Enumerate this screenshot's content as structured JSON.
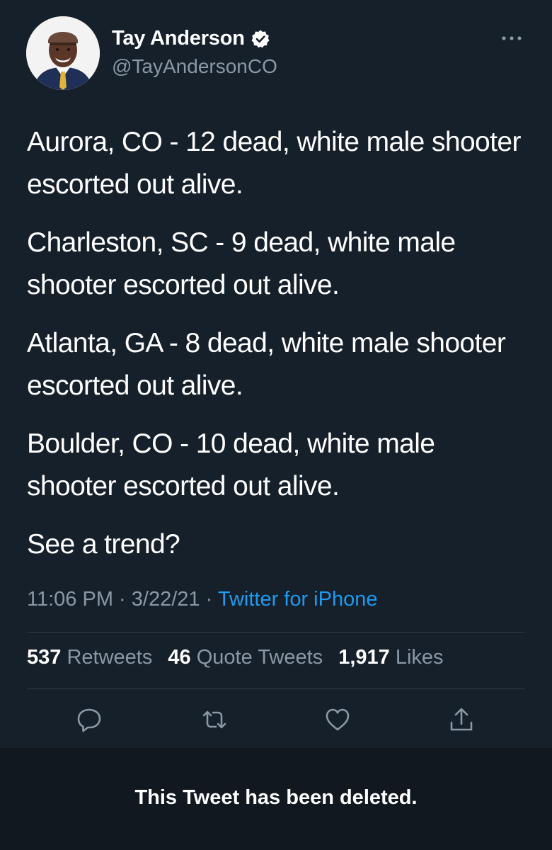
{
  "author": {
    "name": "Tay Anderson",
    "handle": "@TayAndersonCO",
    "verified": true,
    "avatar_icon": "profile-photo"
  },
  "tweet": {
    "lines": [
      "Aurora, CO - 12 dead, white male shooter escorted out alive.",
      "Charleston, SC - 9 dead, white male shooter escorted out alive.",
      "Atlanta, GA - 8 dead, white male shooter escorted out alive.",
      "Boulder, CO - 10 dead, white male shooter escorted out alive.",
      "See a trend?"
    ],
    "time": "11:06 PM",
    "separator": "·",
    "date": "3/22/21",
    "source": "Twitter for iPhone"
  },
  "stats": {
    "retweets_count": "537",
    "retweets_label": "Retweets",
    "quotes_count": "46",
    "quotes_label": "Quote Tweets",
    "likes_count": "1,917",
    "likes_label": "Likes"
  },
  "actions": [
    "reply-icon",
    "retweet-icon",
    "like-icon",
    "share-icon"
  ],
  "notice": {
    "text": "This Tweet has been deleted."
  },
  "colors": {
    "background": "#16202b",
    "secondary_text": "#8b98a5",
    "link": "#1d9bf0",
    "deleted_bar": "#111820"
  }
}
